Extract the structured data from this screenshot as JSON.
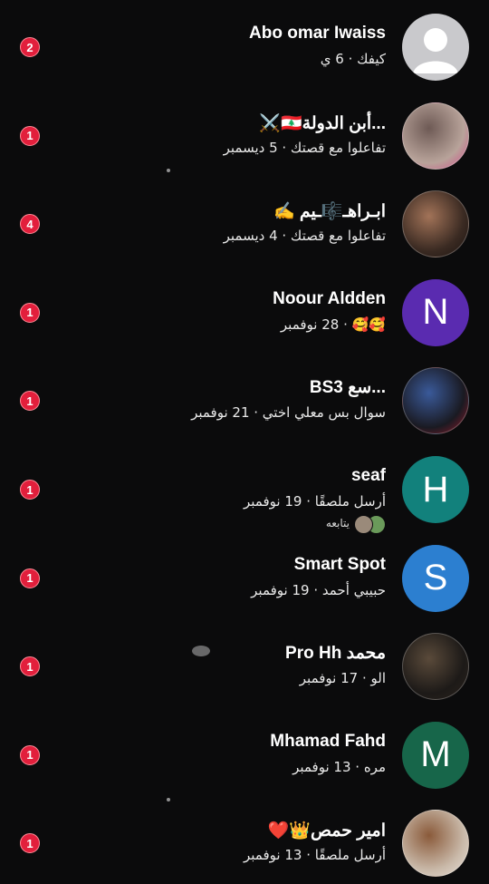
{
  "conversations": [
    {
      "name": "Abo omar Iwaiss",
      "preview": "كيفك · 6 ي",
      "badge": "2",
      "avatar": {
        "type": "placeholder"
      }
    },
    {
      "name": "...أبن الدولة🇱🇧⚔️",
      "preview": "تفاعلوا مع قصتك · 5 ديسمبر",
      "badge": "1",
      "avatar": {
        "type": "photo",
        "colors": [
          "#b8a39a",
          "#6e5a55",
          "#d34a8a"
        ]
      }
    },
    {
      "name": "ابـراهـ🎼ـيم ✍️",
      "preview": "تفاعلوا مع قصتك · 4 ديسمبر",
      "badge": "4",
      "avatar": {
        "type": "photo",
        "colors": [
          "#3a2a22",
          "#a27358",
          "#1b1310"
        ]
      }
    },
    {
      "name": "Noour Aldden",
      "preview": "🥰🥰 · 28 نوفمبر",
      "badge": "1",
      "avatar": {
        "type": "letter",
        "letter": "N",
        "color": "#5a2bb0"
      }
    },
    {
      "name": "...سع BS3",
      "preview": "سوال بس معلي اختي · 21 نوفمبر",
      "badge": "1",
      "avatar": {
        "type": "photo",
        "colors": [
          "#1a1a22",
          "#3a5a9a",
          "#9a1a2a"
        ]
      }
    },
    {
      "name": "seaf",
      "preview": "أرسل ملصقًا · 19 نوفمبر",
      "followers": "يتابعه",
      "badge": "1",
      "avatar": {
        "type": "letter",
        "letter": "H",
        "color": "#12817c"
      }
    },
    {
      "name": "Smart Spot",
      "preview": "حبيبي أحمد · 19 نوفمبر",
      "badge": "1",
      "avatar": {
        "type": "letter",
        "letter": "S",
        "color": "#2c7fd0"
      }
    },
    {
      "name": "Pro Hh محمد",
      "preview": "الو · 17 نوفمبر",
      "badge": "1",
      "avatar": {
        "type": "photo",
        "colors": [
          "#1d1a18",
          "#5a4a3a",
          "#2a221c"
        ]
      }
    },
    {
      "name": "Mhamad Fahd",
      "preview": "مره · 13 نوفمبر",
      "badge": "1",
      "avatar": {
        "type": "letter",
        "letter": "M",
        "color": "#17664a"
      }
    },
    {
      "name": "امير حمص👑❤️",
      "preview": "أرسل ملصقًا · 13 نوفمبر",
      "badge": "1",
      "avatar": {
        "type": "photo",
        "colors": [
          "#c9b9a9",
          "#8a5a3a",
          "#e8e0d8"
        ]
      }
    }
  ]
}
